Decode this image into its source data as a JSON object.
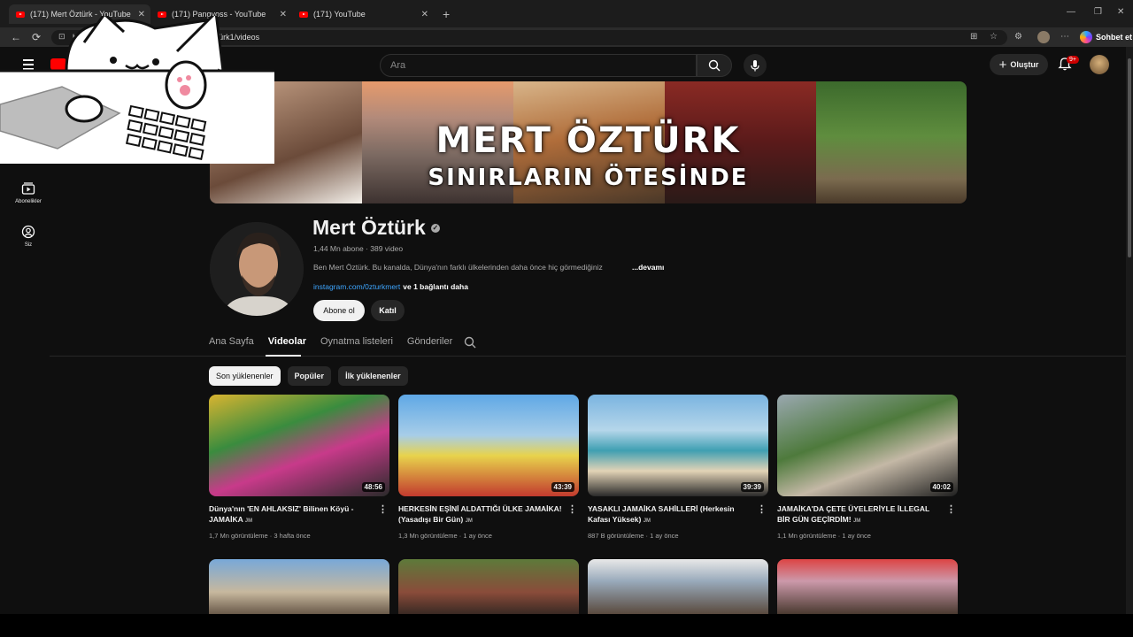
{
  "browser": {
    "tabs": [
      {
        "title": "(171) Mert Öztürk - YouTube"
      },
      {
        "title": "(171) Pangvoss - YouTube"
      },
      {
        "title": "(171) YouTube"
      }
    ],
    "url_start": "https",
    "url_end": "/@MertÖztürk1/videos",
    "copilot_label": "Sohbet et"
  },
  "header": {
    "search_placeholder": "Ara",
    "create_label": "Oluştur",
    "notif_count": "9+"
  },
  "sidebar": {
    "items": [
      {
        "label": "Abonelikler",
        "icon": "subscriptions-icon"
      },
      {
        "label": "Siz",
        "icon": "you-icon"
      }
    ]
  },
  "banner": {
    "line1": "MERT ÖZTÜRK",
    "line2": "SINIRLARIN ÖTESİNDE"
  },
  "channel": {
    "name": "Mert Öztürk",
    "meta": "1,44 Mn abone · 389 video",
    "description": "Ben Mert Öztürk. Bu kanalda, Dünya'nın farklı ülkelerinden daha önce hiç görmediğiniz",
    "more_label": "...devamı",
    "link": "instagram.com/0zturkmert",
    "link_more": "ve 1 bağlantı daha",
    "subscribe_label": "Abone ol",
    "join_label": "Katıl"
  },
  "channel_tabs": [
    {
      "label": "Ana Sayfa",
      "active": false
    },
    {
      "label": "Videolar",
      "active": true
    },
    {
      "label": "Oynatma listeleri",
      "active": false
    },
    {
      "label": "Gönderiler",
      "active": false
    }
  ],
  "chips": [
    {
      "label": "Son yüklenenler",
      "active": true
    },
    {
      "label": "Popüler",
      "active": false
    },
    {
      "label": "İlk yüklenenler",
      "active": false
    }
  ],
  "videos": [
    {
      "title": "Dünya'nın 'EN AHLAKSIZ' Bilinen Köyü - JAMAİKA",
      "tag": "JM",
      "views": "1,7 Mn görüntüleme",
      "age": "3 hafta önce",
      "duration": "48:56"
    },
    {
      "title": "HERKESİN EŞİNİ ALDATTIĞI ÜLKE JAMAİKA! (Yasadışı Bir Gün)",
      "tag": "JM",
      "views": "1,3 Mn görüntüleme",
      "age": "1 ay önce",
      "duration": "43:39"
    },
    {
      "title": "YASAKLI JAMAİKA SAHİLLERİ (Herkesin Kafası Yüksek)",
      "tag": "JM",
      "views": "887 B görüntüleme",
      "age": "1 ay önce",
      "duration": "39:39"
    },
    {
      "title": "JAMAİKA'DA ÇETE ÜYELERİYLE İLLEGAL BİR GÜN GEÇİRDİM!",
      "tag": "JM",
      "views": "1,1 Mn görüntüleme",
      "age": "1 ay önce",
      "duration": "40:02"
    }
  ]
}
